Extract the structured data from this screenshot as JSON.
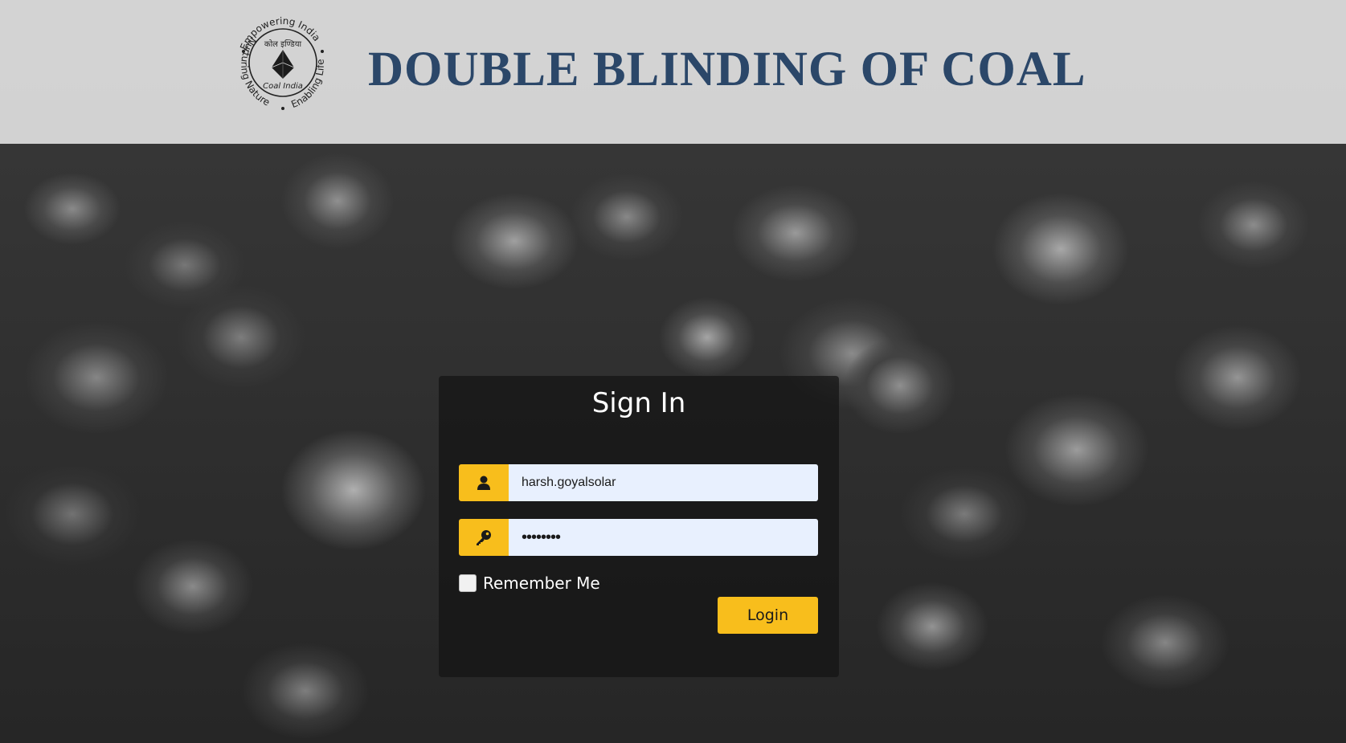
{
  "header": {
    "title": "DOUBLE BLINDING OF COAL",
    "logo": {
      "icon": "coal-india-logo",
      "ring_text_top": "Empowering India",
      "ring_text_left": "Nurturing Nature",
      "ring_text_right": "Enabling Life",
      "hindi_text": "कोल इण्डिया",
      "english_text": "Coal India"
    }
  },
  "login": {
    "title": "Sign In",
    "username": {
      "icon": "user-icon",
      "value": "harsh.goyalsolar"
    },
    "password": {
      "icon": "key-icon",
      "value": "••••••••"
    },
    "remember_me": {
      "label": "Remember Me",
      "checked": false
    },
    "login_button_label": "Login"
  },
  "colors": {
    "accent": "#f8be1c",
    "title_color": "#2b4769",
    "input_bg": "#e8f0fe",
    "panel_bg": "rgba(20,20,20,0.72)"
  }
}
